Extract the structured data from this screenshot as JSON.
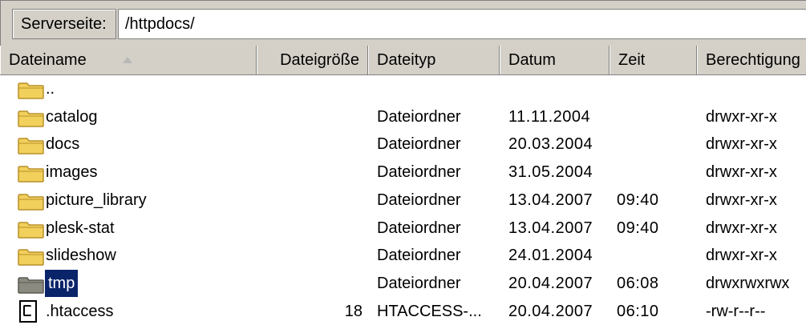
{
  "pathbar": {
    "label": "Serverseite:",
    "value": "/httpdocs/"
  },
  "columns": {
    "name": "Dateiname",
    "size": "Dateigröße",
    "type": "Dateityp",
    "date": "Datum",
    "time": "Zeit",
    "perm": "Berechtigung"
  },
  "files": [
    {
      "name": "..",
      "size": "",
      "type": "",
      "date": "",
      "time": "",
      "perm": "",
      "icon": "folder-icon"
    },
    {
      "name": "catalog",
      "size": "",
      "type": "Dateiordner",
      "date": "11.11.2004",
      "time": "",
      "perm": "drwxr-xr-x",
      "icon": "folder-icon"
    },
    {
      "name": "docs",
      "size": "",
      "type": "Dateiordner",
      "date": "20.03.2004",
      "time": "",
      "perm": "drwxr-xr-x",
      "icon": "folder-icon"
    },
    {
      "name": "images",
      "size": "",
      "type": "Dateiordner",
      "date": "31.05.2004",
      "time": "",
      "perm": "drwxr-xr-x",
      "icon": "folder-icon"
    },
    {
      "name": "picture_library",
      "size": "",
      "type": "Dateiordner",
      "date": "13.04.2007",
      "time": "09:40",
      "perm": "drwxr-xr-x",
      "icon": "folder-icon"
    },
    {
      "name": "plesk-stat",
      "size": "",
      "type": "Dateiordner",
      "date": "13.04.2007",
      "time": "09:40",
      "perm": "drwxr-xr-x",
      "icon": "folder-icon"
    },
    {
      "name": "slideshow",
      "size": "",
      "type": "Dateiordner",
      "date": "24.01.2004",
      "time": "",
      "perm": "drwxr-xr-x",
      "icon": "folder-icon"
    },
    {
      "name": "tmp",
      "size": "",
      "type": "Dateiordner",
      "date": "20.04.2007",
      "time": "06:08",
      "perm": "drwxrwxrwx",
      "icon": "folder-icon",
      "selected": true
    },
    {
      "name": ".htaccess",
      "size": "18",
      "type": "HTACCESS-...",
      "date": "20.04.2007",
      "time": "06:10",
      "perm": "-rw-r--r--",
      "icon": "file-icon"
    }
  ],
  "colors": {
    "selection": "#0a246a",
    "folder": "#f2d05c",
    "chrome": "#d4d0c8"
  }
}
